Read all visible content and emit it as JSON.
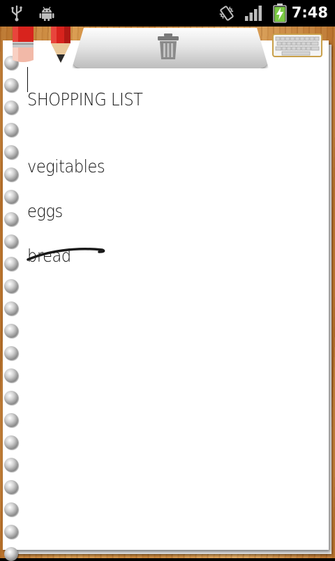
{
  "status_bar": {
    "time": "7:48",
    "icons": [
      "usb-icon",
      "android-debug-icon",
      "vibrate-icon",
      "signal-icon",
      "battery-charging-icon"
    ]
  },
  "toolbar": {
    "eraser": "eraser-icon",
    "pencil": "pencil-icon",
    "trash": "trash-icon",
    "keyboard": "keyboard-icon"
  },
  "note": {
    "lines": [
      "SHOPPING LIST",
      "vegitables",
      "eggs",
      "bread"
    ],
    "crossed_out": [
      "bread"
    ]
  },
  "colors": {
    "wood": "#c9853a",
    "paper": "#ffffff",
    "ink": "#111111",
    "pencil_red": "#d8231d"
  }
}
